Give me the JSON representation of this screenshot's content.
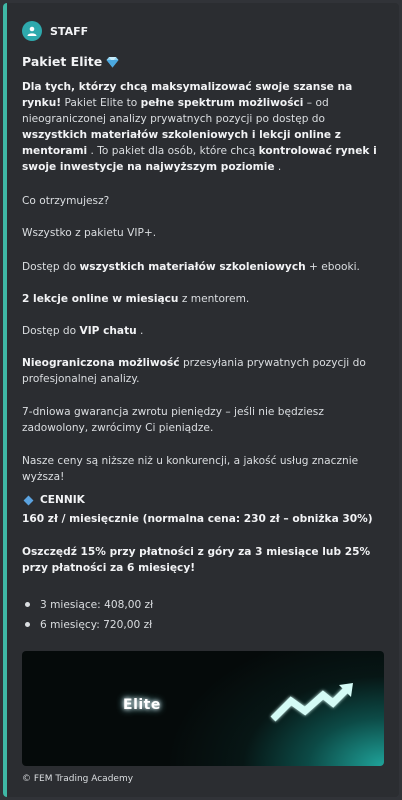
{
  "author": {
    "name": "STAFF",
    "icon": "user-icon"
  },
  "title": {
    "text": "Pakiet Elite",
    "emoji": "gem-icon"
  },
  "description": {
    "p1_b1": "Dla tych, którzy chcą maksymalizować swoje szanse na rynku!",
    "p1_t1": " Pakiet Elite to ",
    "p1_b2": "pełne spektrum możliwości",
    "p1_t2": " – od nieograniczonej analizy prywatnych pozycji po dostęp do ",
    "p1_b3": "wszystkich materiałów szkoleniowych i lekcji online z mentorami",
    "p1_t3": " . To pakiet dla osób, które chcą ",
    "p1_b4": "kontrolować rynek i swoje inwestycje na najwyższym poziomie",
    "p1_t4": " .",
    "q": "Co otrzymujesz?",
    "l1": "Wszystko z pakietu VIP+.",
    "l2_t1": "Dostęp do ",
    "l2_b": "wszystkich materiałów szkoleniowych",
    "l2_t2": " + ebooki.",
    "l3_b": "2 lekcje online w miesiącu",
    "l3_t": " z mentorem.",
    "l4_t1": "Dostęp do ",
    "l4_b": "VIP chatu",
    "l4_t2": " .",
    "l5_b": "Nieograniczona możliwość",
    "l5_t": " przesyłania prywatnych pozycji do profesjonalnej analizy.",
    "l6": "7-dniowa gwarancja zwrotu pieniędzy – jeśli nie będziesz zadowolony, zwrócimy Ci pieniądze.",
    "l7": "Nasze ceny są niższe niż u konkurencji, a jakość usług znacznie wyższa!"
  },
  "pricing": {
    "heading": "CENNIK",
    "monthly": "160 zł / miesięcznie (normalna cena: 230 zł – obniżka 30%)",
    "savings": "Oszczędź 15% przy płatności z góry za 3 miesiące lub 25% przy płatności za 6 miesięcy!",
    "items": [
      "3 miesiące: 408,00 zł",
      "6 miesięcy: 720,00 zł"
    ]
  },
  "banner": {
    "text": "Elite"
  },
  "footer": {
    "text": "© FEM Trading Academy"
  },
  "colors": {
    "accent": "#3fb8a6",
    "background": "#2b2d31",
    "diamond": "#5ba3e0"
  }
}
